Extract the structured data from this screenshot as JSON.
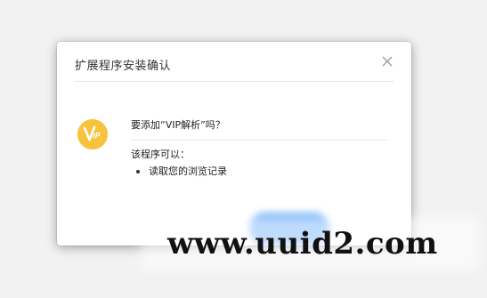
{
  "dialog": {
    "title": "扩展程序安装确认",
    "close_icon": "close-icon",
    "colors": {
      "background": "#ffffff",
      "divider": "#e6e6e6",
      "text": "#333333"
    }
  },
  "extension": {
    "icon": "vip-extension-icon",
    "icon_color": "#f7c33d",
    "question": "要添加“VIP解析”吗？",
    "permissions_heading": "该程序可以：",
    "permissions": [
      "读取您的浏览记录"
    ]
  },
  "actions": {
    "add_button_color": "#5aa4f8"
  },
  "watermark": {
    "text": "www.uuid2.com"
  }
}
